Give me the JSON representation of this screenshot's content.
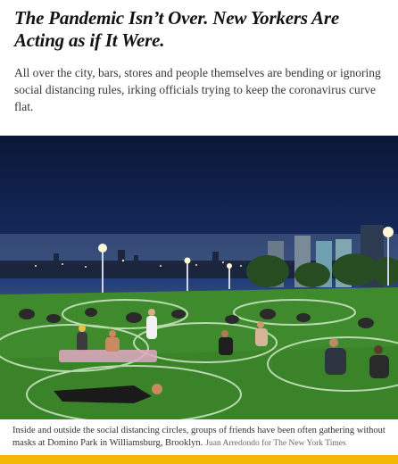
{
  "article": {
    "headline": "The Pandemic Isn’t Over. New Yorkers Are Acting as if It Were.",
    "summary": "All over the city, bars, stores and people themselves are bending or ignoring social distancing rules, irking officials trying to keep the coronavirus curve flat.",
    "photo": {
      "caption": "Inside and outside the social distancing circles, groups of friends have been often gathering without masks at Domino Park in Williamsburg, Brooklyn.",
      "credit": "Juan Arredondo for The New York Times"
    }
  },
  "colors": {
    "accent_bar": "#f2b705",
    "headline": "#121212",
    "summary": "#363636"
  }
}
